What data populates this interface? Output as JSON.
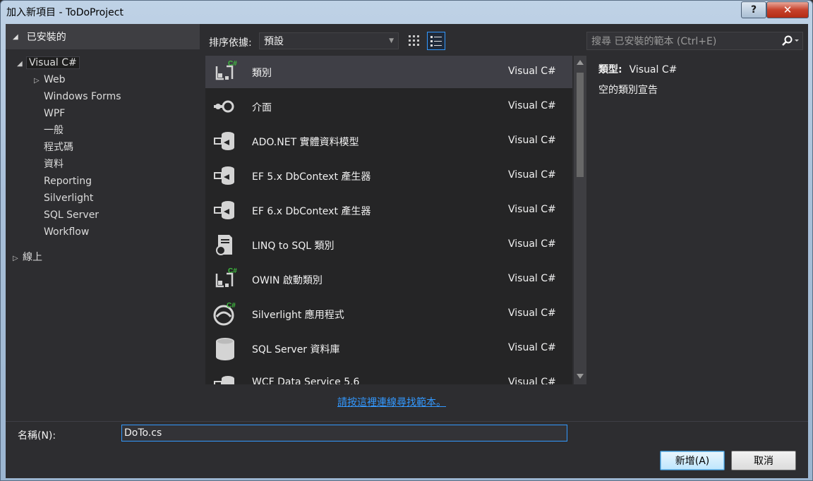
{
  "window": {
    "title": "加入新項目 - ToDoProject",
    "help_label": "?",
    "close_label": "✕"
  },
  "tree": {
    "header": "已安裝的",
    "nodes": [
      {
        "label": "Visual C#",
        "level": 0,
        "expand": "expanded",
        "selected": true
      },
      {
        "label": "Web",
        "level": 1,
        "expand": "collapsed",
        "selected": false
      },
      {
        "label": "Windows Forms",
        "level": 1,
        "expand": "none",
        "selected": false
      },
      {
        "label": "WPF",
        "level": 1,
        "expand": "none",
        "selected": false
      },
      {
        "label": "一般",
        "level": 1,
        "expand": "none",
        "selected": false
      },
      {
        "label": "程式碼",
        "level": 1,
        "expand": "none",
        "selected": false
      },
      {
        "label": "資料",
        "level": 1,
        "expand": "none",
        "selected": false
      },
      {
        "label": "Reporting",
        "level": 1,
        "expand": "none",
        "selected": false
      },
      {
        "label": "Silverlight",
        "level": 1,
        "expand": "none",
        "selected": false
      },
      {
        "label": "SQL Server",
        "level": 1,
        "expand": "none",
        "selected": false
      },
      {
        "label": "Workflow",
        "level": 1,
        "expand": "none",
        "selected": false
      }
    ],
    "online": "線上"
  },
  "toolbar": {
    "sort_label": "排序依據:",
    "sort_value": "預設",
    "search_placeholder": "搜尋 已安裝的範本 (Ctrl+E)"
  },
  "templates": [
    {
      "name": "類別",
      "lang": "Visual C#",
      "icon": "class-cs-icon",
      "selected": true
    },
    {
      "name": "介面",
      "lang": "Visual C#",
      "icon": "interface-icon",
      "selected": false
    },
    {
      "name": "ADO.NET 實體資料模型",
      "lang": "Visual C#",
      "icon": "entity-model-icon",
      "selected": false
    },
    {
      "name": "EF 5.x DbContext 產生器",
      "lang": "Visual C#",
      "icon": "dbcontext-generator-icon",
      "selected": false
    },
    {
      "name": "EF 6.x DbContext 產生器",
      "lang": "Visual C#",
      "icon": "dbcontext-generator-icon",
      "selected": false
    },
    {
      "name": "LINQ to SQL 類別",
      "lang": "Visual C#",
      "icon": "linq-to-sql-icon",
      "selected": false
    },
    {
      "name": "OWIN 啟動類別",
      "lang": "Visual C#",
      "icon": "class-cs-icon",
      "selected": false
    },
    {
      "name": "Silverlight 應用程式",
      "lang": "Visual C#",
      "icon": "silverlight-icon",
      "selected": false
    },
    {
      "name": "SQL Server 資料庫",
      "lang": "Visual C#",
      "icon": "database-icon",
      "selected": false
    },
    {
      "name": "WCF Data Service 5.6",
      "lang": "Visual C#",
      "icon": "data-service-icon",
      "selected": false
    }
  ],
  "details": {
    "type_label": "類型:",
    "type_value": "Visual C#",
    "description": "空的類別宣告"
  },
  "online_link": "請按這裡連線尋找範本。",
  "form": {
    "name_label": "名稱(N):",
    "name_value": "DoTo.cs"
  },
  "buttons": {
    "add": "新增(A)",
    "cancel": "取消"
  },
  "colors": {
    "accent": "#3399ff",
    "background": "#2d2d30",
    "list_bg": "#252526",
    "selected_row": "#3f3f46"
  }
}
